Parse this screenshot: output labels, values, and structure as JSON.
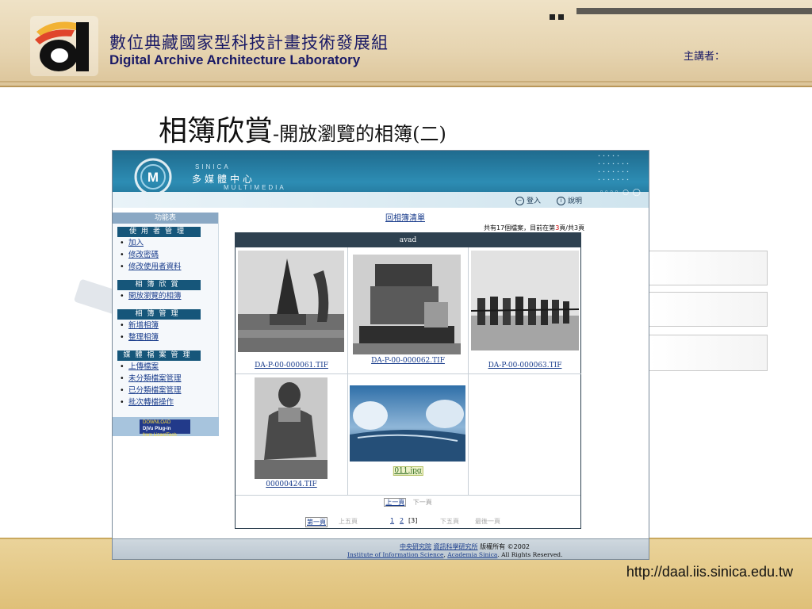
{
  "slide": {
    "lab_name_zh": "數位典藏國家型科技計畫技術發展組",
    "lab_name_en": "Digital Archive Architecture Laboratory",
    "speaker_label": "主講者：",
    "title_main": "相簿欣賞",
    "title_sub": "-開放瀏覽的相簿(二)",
    "footer_url": "http://daal.iis.sinica.edu.tw"
  },
  "site": {
    "banner": {
      "sinica": "SINICA",
      "name": "多媒體中心",
      "multimedia": "MULTIMEDIA",
      "login": "登入",
      "help": "說明"
    },
    "menu_title": "功能表",
    "groups": [
      {
        "head": "使用者管理",
        "items": [
          "加入",
          "修改密碼",
          "修改使用者資料"
        ]
      },
      {
        "head": "相簿欣賞",
        "items": [
          "開放瀏覽的相簿"
        ]
      },
      {
        "head": "相簿管理",
        "items": [
          "新增相簿",
          "整理相簿"
        ]
      },
      {
        "head": "媒體檔案管理",
        "items": [
          "上傳檔案",
          "未分類檔案管理",
          "已分類檔案管理",
          "批次轉檔操作"
        ]
      }
    ],
    "plugin": {
      "top": "DOWNLOAD",
      "name": "DjVu Plug-in",
      "sub": "from LizardTech"
    },
    "album_list_link": "回相簿清單",
    "count": {
      "prefix": "共有17個檔案，目前在第",
      "page": "3",
      "suffix": "頁/共3頁"
    },
    "album_name": "avad",
    "files": [
      "DA-P-00-000061.TIF",
      "DA-P-00-000062.TIF",
      "DA-P-00-000063.TIF",
      "00000424.TIF",
      "011.jpg"
    ],
    "pager": {
      "prev": "上一頁",
      "next": "下一頁",
      "first": "第一頁",
      "prev5": "上五頁",
      "page1": "1",
      "page2": "2",
      "page3": "[3]",
      "next5": "下五頁",
      "last": "最後一頁"
    },
    "footer": {
      "org1": "中央研究院",
      "org2": "資訊科學研究所",
      "copyright": "版權所有 ©2002",
      "en1": "Institute of Information Science",
      "en_sep": ",",
      "en2": "Academia Sinica",
      "en_rights": ". All Rights Reserved."
    }
  },
  "colors": {
    "banner_blue": "#2d8db4",
    "menu_head": "#16567a",
    "album_head": "#2e4150",
    "link": "#1a3d8c"
  }
}
